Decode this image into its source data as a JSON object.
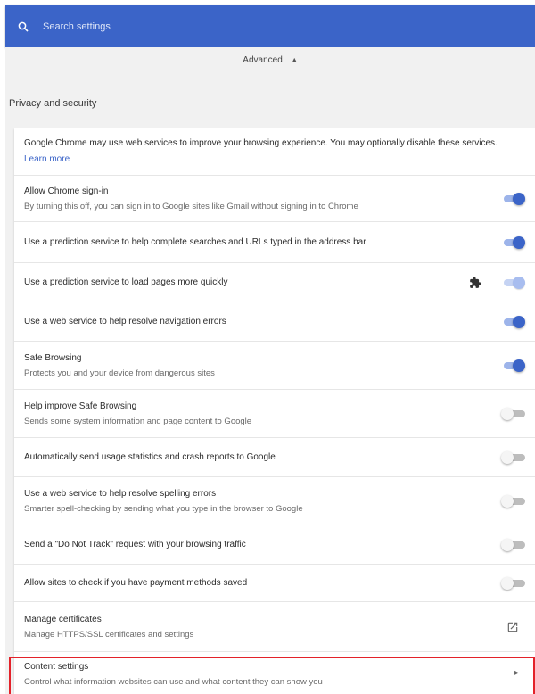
{
  "search": {
    "placeholder": "Search settings",
    "icon": "search-icon"
  },
  "advanced": {
    "label": "Advanced",
    "arrow": "▲"
  },
  "section": {
    "title": "Privacy and security"
  },
  "intro": {
    "text": "Google Chrome may use web services to improve your browsing experience. You may optionally disable these services.",
    "link": "Learn more"
  },
  "rows": [
    {
      "title": "Allow Chrome sign-in",
      "sub": "By turning this off, you can sign in to Google sites like Gmail without signing in to Chrome",
      "toggle": "on"
    },
    {
      "title": "Use a prediction service to help complete searches and URLs typed in the address bar",
      "toggle": "on"
    },
    {
      "title": "Use a prediction service to load pages more quickly",
      "toggle": "on-disabled",
      "icon": "puzzle-piece-icon"
    },
    {
      "title": "Use a web service to help resolve navigation errors",
      "toggle": "on"
    },
    {
      "title": "Safe Browsing",
      "sub": "Protects you and your device from dangerous sites",
      "toggle": "on"
    },
    {
      "title": "Help improve Safe Browsing",
      "sub": "Sends some system information and page content to Google",
      "toggle": "off"
    },
    {
      "title": "Automatically send usage statistics and crash reports to Google",
      "toggle": "off"
    },
    {
      "title": "Use a web service to help resolve spelling errors",
      "sub": "Smarter spell-checking by sending what you type in the browser to Google",
      "toggle": "off"
    },
    {
      "title": "Send a \"Do Not Track\" request with your browsing traffic",
      "toggle": "off"
    },
    {
      "title": "Allow sites to check if you have payment methods saved",
      "toggle": "off"
    },
    {
      "title": "Manage certificates",
      "sub": "Manage HTTPS/SSL certificates and settings",
      "icon": "external-link-icon"
    },
    {
      "title": "Content settings",
      "sub": "Control what information websites can use and what content they can show you",
      "icon": "chevron-right-icon",
      "highlighted": true
    }
  ],
  "colors": {
    "accent": "#3b64c8",
    "highlight": "#e3222a",
    "background": "#f1f1f1"
  }
}
